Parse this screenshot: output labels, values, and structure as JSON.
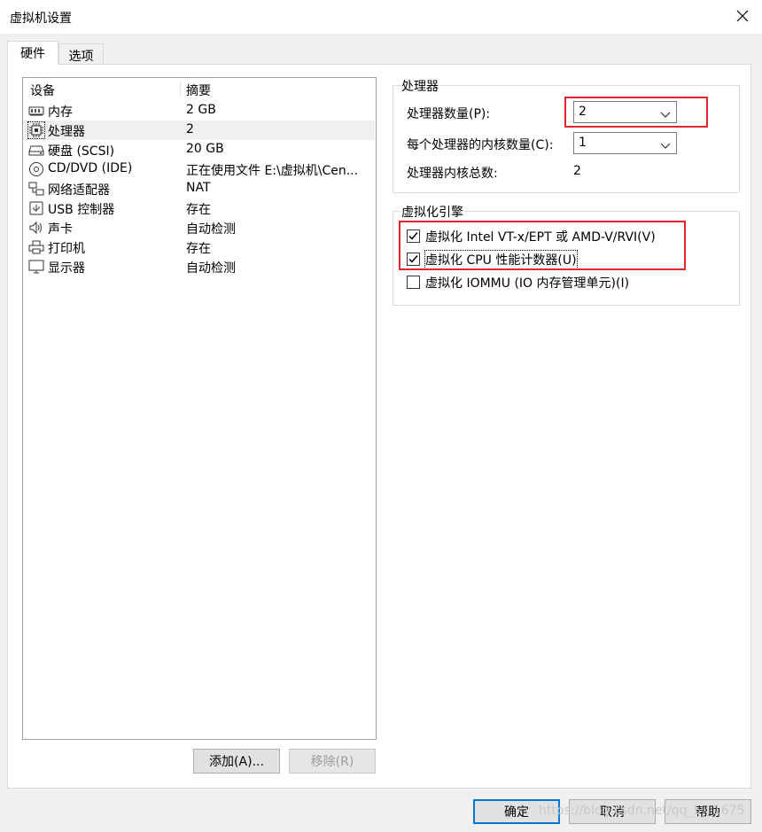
{
  "window": {
    "title": "虚拟机设置"
  },
  "tabs": [
    {
      "label": "硬件",
      "active": true
    },
    {
      "label": "选项",
      "active": false
    }
  ],
  "device_list": {
    "headers": {
      "device": "设备",
      "summary": "摘要"
    },
    "rows": [
      {
        "icon": "memory-icon",
        "name": "内存",
        "summary": "2 GB"
      },
      {
        "icon": "processor-icon",
        "name": "处理器",
        "summary": "2",
        "selected": true
      },
      {
        "icon": "harddisk-icon",
        "name": "硬盘 (SCSI)",
        "summary": "20 GB"
      },
      {
        "icon": "cd-dvd-icon",
        "name": "CD/DVD (IDE)",
        "summary": "正在使用文件 E:\\虚拟机\\Cen..."
      },
      {
        "icon": "network-adapter-icon",
        "name": "网络适配器",
        "summary": "NAT"
      },
      {
        "icon": "usb-icon",
        "name": "USB 控制器",
        "summary": "存在"
      },
      {
        "icon": "sound-icon",
        "name": "声卡",
        "summary": "自动检测"
      },
      {
        "icon": "printer-icon",
        "name": "打印机",
        "summary": "存在"
      },
      {
        "icon": "display-icon",
        "name": "显示器",
        "summary": "自动检测"
      }
    ]
  },
  "list_buttons": {
    "add": "添加(A)...",
    "remove": "移除(R)"
  },
  "processor_group": {
    "legend": "处理器",
    "count_label": "处理器数量(P):",
    "count_value": "2",
    "cores_label": "每个处理器的内核数量(C):",
    "cores_value": "1",
    "total_label": "处理器内核总数:",
    "total_value": "2"
  },
  "virt_group": {
    "legend": "虚拟化引擎",
    "options": [
      {
        "label": "虚拟化 Intel VT-x/EPT 或 AMD-V/RVI(V)",
        "checked": true
      },
      {
        "label": "虚拟化 CPU 性能计数器(U)",
        "checked": true
      },
      {
        "label": "虚拟化 IOMMU (IO 内存管理单元)(I)",
        "checked": false
      }
    ]
  },
  "footer": {
    "ok": "确定",
    "cancel": "取消",
    "help": "帮助"
  },
  "watermark": "https://blog.csdn.net/qq_5...1675",
  "colors": {
    "highlight_red": "#e0262e",
    "default_button_border": "#0078d7"
  }
}
